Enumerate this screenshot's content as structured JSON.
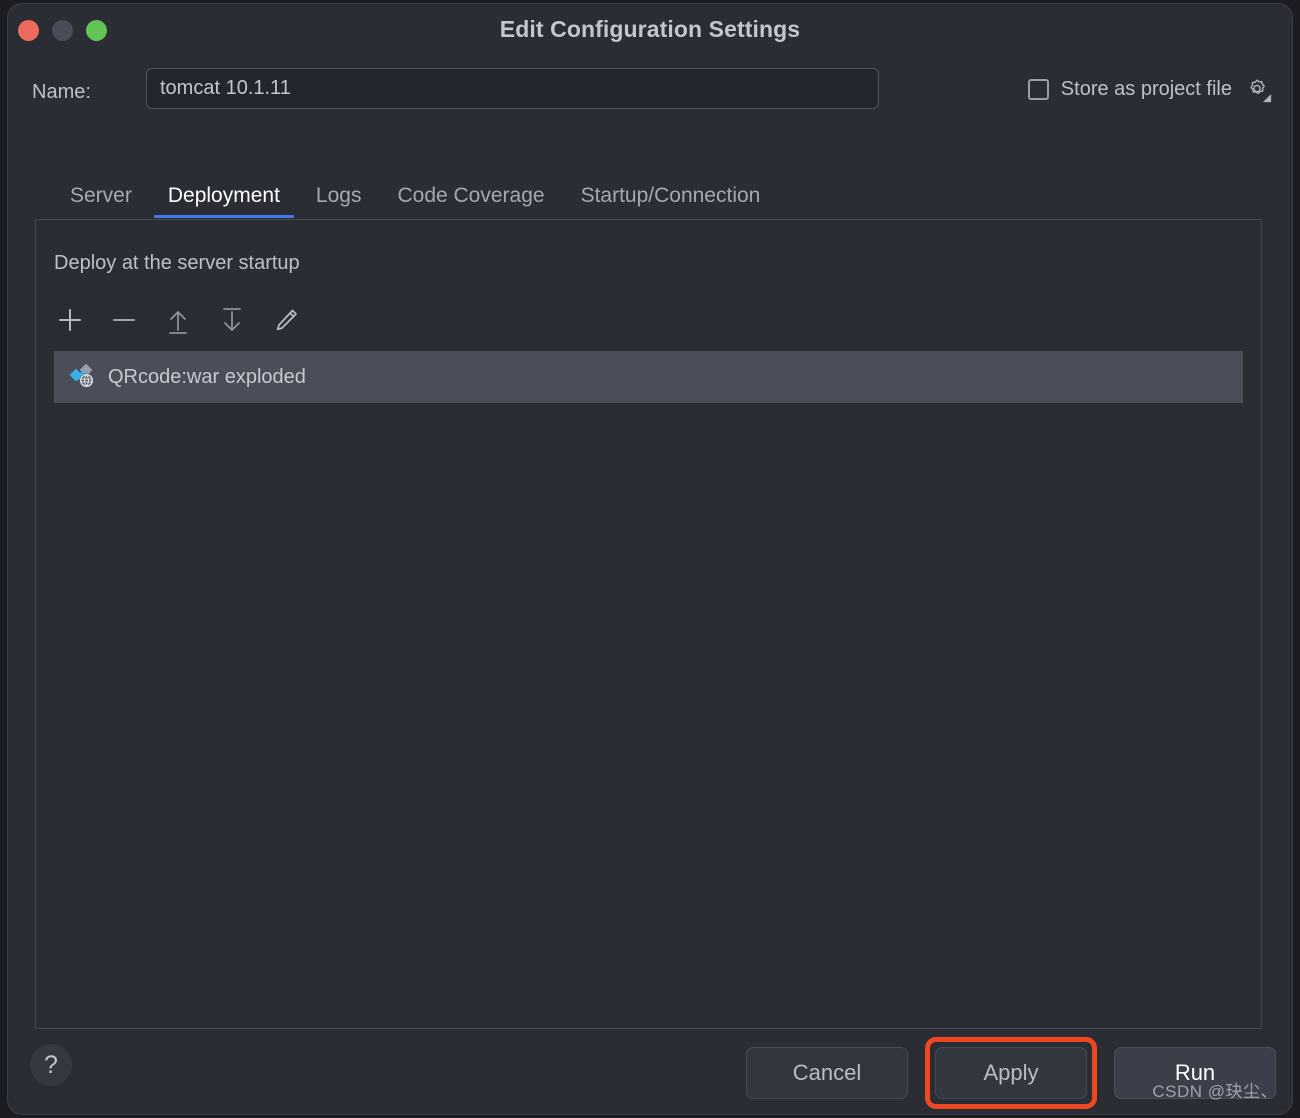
{
  "window": {
    "title": "Edit Configuration Settings",
    "traffic_lights": [
      {
        "name": "close",
        "color": "#ec6a5e"
      },
      {
        "name": "minimize",
        "color": "#4a4d57"
      },
      {
        "name": "zoom",
        "color": "#61c454"
      }
    ]
  },
  "name_row": {
    "label": "Name:",
    "value": "tomcat 10.1.11",
    "placeholder": "Name",
    "store_as_project_file": {
      "label": "Store as project file",
      "checked": false,
      "gear_icon": "gear-icon"
    }
  },
  "tabs": [
    {
      "label": "Server",
      "active": false
    },
    {
      "label": "Deployment",
      "active": true
    },
    {
      "label": "Logs",
      "active": false
    },
    {
      "label": "Code Coverage",
      "active": false
    },
    {
      "label": "Startup/Connection",
      "active": false
    }
  ],
  "deployment": {
    "section_title": "Deploy at the server startup",
    "toolbar": [
      {
        "name": "add-button",
        "icon": "plus-icon",
        "tooltip": "Add"
      },
      {
        "name": "remove-button",
        "icon": "minus-icon",
        "tooltip": "Remove"
      },
      {
        "name": "move-up-button",
        "icon": "arrow-up-icon",
        "tooltip": "Move Up"
      },
      {
        "name": "move-down-button",
        "icon": "arrow-down-icon",
        "tooltip": "Move Down"
      },
      {
        "name": "edit-button",
        "icon": "pencil-icon",
        "tooltip": "Edit"
      }
    ],
    "items": [
      {
        "label": "QRcode:war exploded",
        "icon": "web-artifact-icon",
        "selected": true
      }
    ]
  },
  "footer": {
    "help_label": "?",
    "buttons": [
      {
        "label": "Cancel",
        "style": "normal",
        "highlighted": false
      },
      {
        "label": "Apply",
        "style": "normal",
        "highlighted": true
      },
      {
        "label": "Run",
        "style": "default",
        "highlighted": false
      }
    ]
  },
  "watermark": "CSDN @玦尘、",
  "colors": {
    "window_bg": "#2b2d35",
    "input_bg": "#24262e",
    "accent_tab": "#3f7ae8",
    "selection": "#4b4e59",
    "highlight_outline": "#f04723",
    "text_primary": "#c3c6cd",
    "text_muted": "#a4a8b2"
  }
}
